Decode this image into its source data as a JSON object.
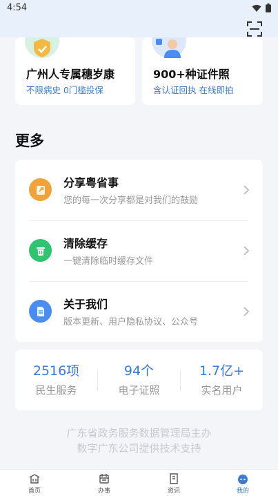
{
  "status_bar": {
    "time": "4:54"
  },
  "header": {
    "scan_icon": "scan-icon"
  },
  "promos": [
    {
      "title": "广州人专属穗岁康",
      "subtitle": "不限病史 0门槛投保",
      "icon": "shield-check-icon"
    },
    {
      "title": "900+种证件照",
      "subtitle": "含认证回执 在线即拍",
      "icon": "portrait-photo-icon"
    }
  ],
  "more": {
    "title": "更多",
    "items": [
      {
        "label": "分享粤省事",
        "desc": "您的每一次分享都是对我们的鼓励",
        "icon": "share-icon",
        "color": "#f0a33b"
      },
      {
        "label": "清除缓存",
        "desc": "一键清除临时缓存文件",
        "icon": "trash-icon",
        "color": "#2fc46f"
      },
      {
        "label": "关于我们",
        "desc": "版本更新、用户隐私协议、公众号",
        "icon": "document-icon",
        "color": "#4a8df0"
      }
    ]
  },
  "stats": [
    {
      "value": "2516项",
      "label": "民生服务"
    },
    {
      "value": "94个",
      "label": "电子证照"
    },
    {
      "value": "1.7亿+",
      "label": "实名用户"
    }
  ],
  "footer": {
    "line1": "广东省政务服务数据管理局主办",
    "line2": "数字广东公司提供技术支持"
  },
  "tabs": [
    {
      "label": "首页",
      "icon": "home-icon"
    },
    {
      "label": "办事",
      "icon": "calendar-icon"
    },
    {
      "label": "资讯",
      "icon": "news-icon"
    },
    {
      "label": "我的",
      "icon": "profile-icon",
      "active": true
    }
  ],
  "colors": {
    "accent": "#3a7bd5",
    "header_bg": "#e8f0fb",
    "page_bg": "#f3f5f9"
  }
}
